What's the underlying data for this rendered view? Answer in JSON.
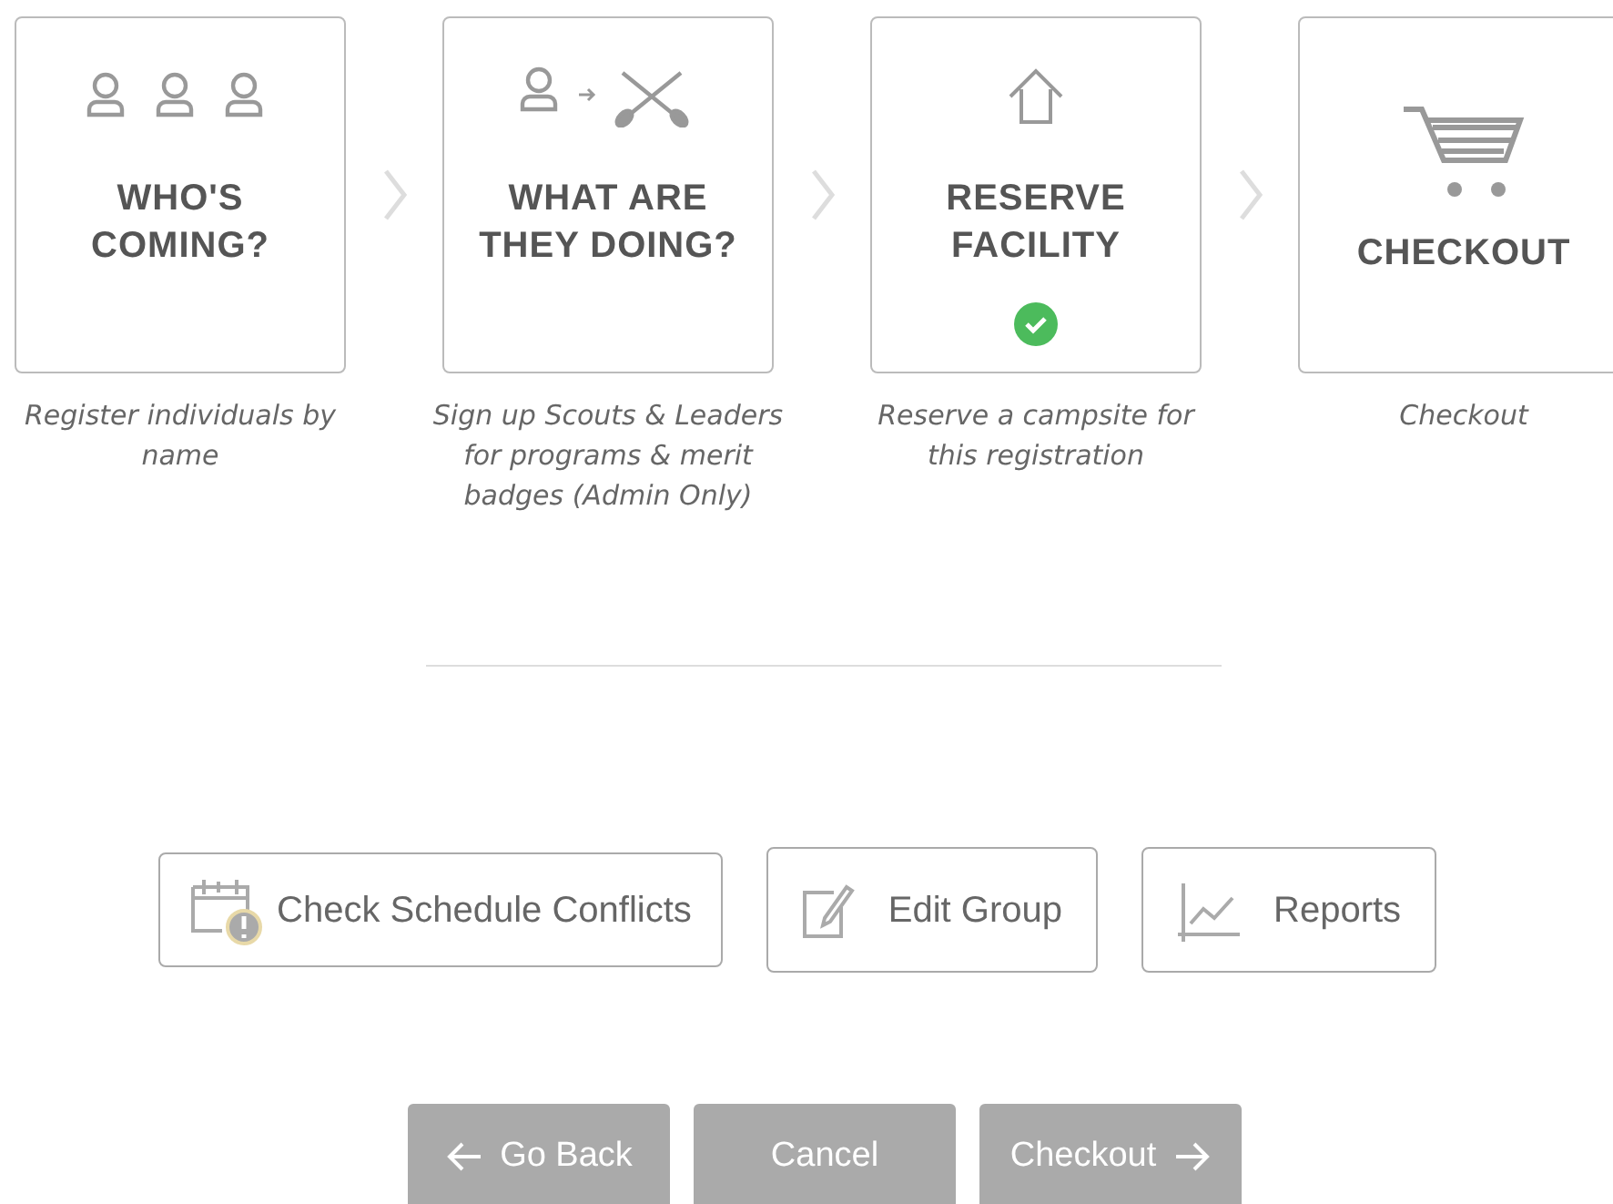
{
  "steps": [
    {
      "kind": "people",
      "title": "WHO'S COMING?",
      "completed": false,
      "description": "Register individuals by name"
    },
    {
      "kind": "activity",
      "title": "WHAT ARE THEY DOING?",
      "completed": false,
      "description": "Sign up Scouts & Leaders for programs & merit badges (Admin Only)"
    },
    {
      "kind": "facility",
      "title": "RESERVE FACILITY",
      "completed": true,
      "description": "Reserve a campsite for this registration"
    },
    {
      "kind": "cart",
      "title": "CHECKOUT",
      "completed": false,
      "description": "Checkout"
    }
  ],
  "actions": [
    {
      "kind": "schedule",
      "label": "Check Schedule Conflicts"
    },
    {
      "kind": "edit",
      "label": "Edit Group"
    },
    {
      "kind": "reports",
      "label": "Reports"
    }
  ],
  "nav_buttons": [
    {
      "kind": "back",
      "label": "Go Back"
    },
    {
      "kind": "plain",
      "label": "Cancel"
    },
    {
      "kind": "forward",
      "label": "Checkout"
    }
  ]
}
